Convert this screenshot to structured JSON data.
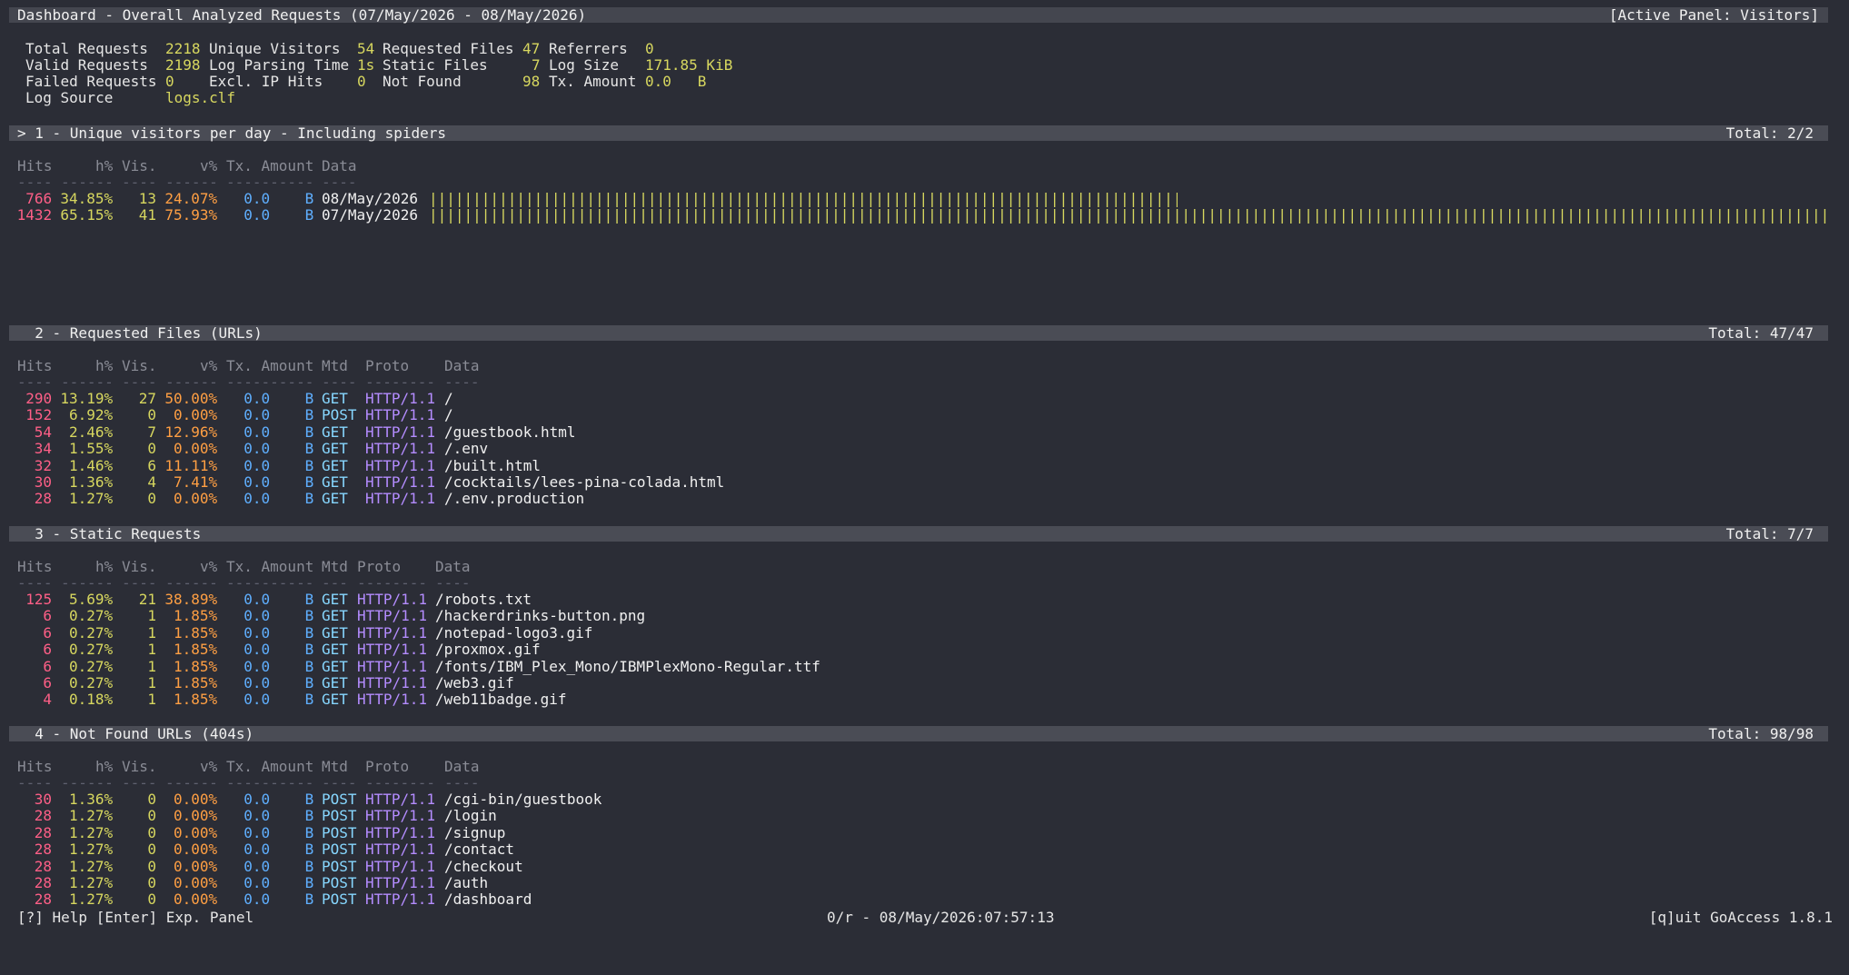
{
  "header": {
    "title": "Dashboard - Overall Analyzed Requests (07/May/2026 - 08/May/2026)",
    "active_panel": "[Active Panel: Visitors]"
  },
  "overview": {
    "total_requests_label": "Total Requests",
    "total_requests": "2218",
    "unique_visitors_label": "Unique Visitors",
    "unique_visitors": "54",
    "requested_files_label": "Requested Files",
    "requested_files": "47",
    "referrers_label": "Referrers",
    "referrers": "0",
    "valid_requests_label": "Valid Requests",
    "valid_requests": "2198",
    "log_parsing_time_label": "Log Parsing Time",
    "log_parsing_time": "1s",
    "static_files_label": "Static Files",
    "static_files": "7",
    "log_size_label": "Log Size",
    "log_size": "171.85 KiB",
    "failed_requests_label": "Failed Requests",
    "failed_requests": "0",
    "excl_ip_hits_label": "Excl. IP Hits",
    "excl_ip_hits": "0",
    "not_found_label": "Not Found",
    "not_found": "98",
    "tx_amount_label": "Tx. Amount",
    "tx_amount": "0.0   B",
    "log_source_label": "Log Source",
    "log_source": "logs.clf"
  },
  "panel1": {
    "title": "> 1 - Unique visitors per day - Including spiders",
    "total": "Total: 2/2",
    "headers": {
      "hits": "Hits",
      "hpct": "h%",
      "vis": "Vis.",
      "vpct": "v%",
      "tx": "Tx. Amount",
      "data": "Data"
    },
    "dashes": {
      "hits": "----",
      "hpct": "------",
      "vis": "----",
      "vpct": "------",
      "tx": "----------",
      "data": "----"
    },
    "rows": [
      {
        "hits": "766",
        "hpct": "34.85%",
        "vis": "13",
        "vpct": "24.07%",
        "tx": "0.0    B",
        "data": "08/May/2026",
        "bar_fraction": 0.535
      },
      {
        "hits": "1432",
        "hpct": "65.15%",
        "vis": "41",
        "vpct": "75.93%",
        "tx": "0.0    B",
        "data": "07/May/2026",
        "bar_fraction": 1.0
      }
    ]
  },
  "panel2": {
    "title": "  2 - Requested Files (URLs)",
    "total": "Total: 47/47",
    "headers": {
      "hits": "Hits",
      "hpct": "h%",
      "vis": "Vis.",
      "vpct": "v%",
      "tx": "Tx. Amount",
      "mtd": "Mtd",
      "proto": "Proto",
      "data": "Data"
    },
    "dashes": {
      "hits": "----",
      "hpct": "------",
      "vis": "----",
      "vpct": "------",
      "tx": "----------",
      "mtd": "----",
      "proto": "--------",
      "data": "----"
    },
    "rows": [
      {
        "hits": "290",
        "hpct": "13.19%",
        "vis": "27",
        "vpct": "50.00%",
        "tx": "0.0    B",
        "mtd": "GET",
        "proto": "HTTP/1.1",
        "data": "/"
      },
      {
        "hits": "152",
        "hpct": "6.92%",
        "vis": "0",
        "vpct": "0.00%",
        "tx": "0.0    B",
        "mtd": "POST",
        "proto": "HTTP/1.1",
        "data": "/"
      },
      {
        "hits": "54",
        "hpct": "2.46%",
        "vis": "7",
        "vpct": "12.96%",
        "tx": "0.0    B",
        "mtd": "GET",
        "proto": "HTTP/1.1",
        "data": "/guestbook.html"
      },
      {
        "hits": "34",
        "hpct": "1.55%",
        "vis": "0",
        "vpct": "0.00%",
        "tx": "0.0    B",
        "mtd": "GET",
        "proto": "HTTP/1.1",
        "data": "/.env"
      },
      {
        "hits": "32",
        "hpct": "1.46%",
        "vis": "6",
        "vpct": "11.11%",
        "tx": "0.0    B",
        "mtd": "GET",
        "proto": "HTTP/1.1",
        "data": "/built.html"
      },
      {
        "hits": "30",
        "hpct": "1.36%",
        "vis": "4",
        "vpct": "7.41%",
        "tx": "0.0    B",
        "mtd": "GET",
        "proto": "HTTP/1.1",
        "data": "/cocktails/lees-pina-colada.html"
      },
      {
        "hits": "28",
        "hpct": "1.27%",
        "vis": "0",
        "vpct": "0.00%",
        "tx": "0.0    B",
        "mtd": "GET",
        "proto": "HTTP/1.1",
        "data": "/.env.production"
      }
    ]
  },
  "panel3": {
    "title": "  3 - Static Requests",
    "total": "Total: 7/7",
    "headers": {
      "hits": "Hits",
      "hpct": "h%",
      "vis": "Vis.",
      "vpct": "v%",
      "tx": "Tx. Amount",
      "mtd": "Mtd",
      "proto": "Proto",
      "data": "Data"
    },
    "dashes": {
      "hits": "----",
      "hpct": "------",
      "vis": "----",
      "vpct": "------",
      "tx": "----------",
      "mtd": "---",
      "proto": "--------",
      "data": "----"
    },
    "rows": [
      {
        "hits": "125",
        "hpct": "5.69%",
        "vis": "21",
        "vpct": "38.89%",
        "tx": "0.0    B",
        "mtd": "GET",
        "proto": "HTTP/1.1",
        "data": "/robots.txt"
      },
      {
        "hits": "6",
        "hpct": "0.27%",
        "vis": "1",
        "vpct": "1.85%",
        "tx": "0.0    B",
        "mtd": "GET",
        "proto": "HTTP/1.1",
        "data": "/hackerdrinks-button.png"
      },
      {
        "hits": "6",
        "hpct": "0.27%",
        "vis": "1",
        "vpct": "1.85%",
        "tx": "0.0    B",
        "mtd": "GET",
        "proto": "HTTP/1.1",
        "data": "/notepad-logo3.gif"
      },
      {
        "hits": "6",
        "hpct": "0.27%",
        "vis": "1",
        "vpct": "1.85%",
        "tx": "0.0    B",
        "mtd": "GET",
        "proto": "HTTP/1.1",
        "data": "/proxmox.gif"
      },
      {
        "hits": "6",
        "hpct": "0.27%",
        "vis": "1",
        "vpct": "1.85%",
        "tx": "0.0    B",
        "mtd": "GET",
        "proto": "HTTP/1.1",
        "data": "/fonts/IBM_Plex_Mono/IBMPlexMono-Regular.ttf"
      },
      {
        "hits": "6",
        "hpct": "0.27%",
        "vis": "1",
        "vpct": "1.85%",
        "tx": "0.0    B",
        "mtd": "GET",
        "proto": "HTTP/1.1",
        "data": "/web3.gif"
      },
      {
        "hits": "4",
        "hpct": "0.18%",
        "vis": "1",
        "vpct": "1.85%",
        "tx": "0.0    B",
        "mtd": "GET",
        "proto": "HTTP/1.1",
        "data": "/web11badge.gif"
      }
    ]
  },
  "panel4": {
    "title": "  4 - Not Found URLs (404s)",
    "total": "Total: 98/98",
    "headers": {
      "hits": "Hits",
      "hpct": "h%",
      "vis": "Vis.",
      "vpct": "v%",
      "tx": "Tx. Amount",
      "mtd": "Mtd",
      "proto": "Proto",
      "data": "Data"
    },
    "dashes": {
      "hits": "----",
      "hpct": "------",
      "vis": "----",
      "vpct": "------",
      "tx": "----------",
      "mtd": "----",
      "proto": "--------",
      "data": "----"
    },
    "rows": [
      {
        "hits": "30",
        "hpct": "1.36%",
        "vis": "0",
        "vpct": "0.00%",
        "tx": "0.0    B",
        "mtd": "POST",
        "proto": "HTTP/1.1",
        "data": "/cgi-bin/guestbook"
      },
      {
        "hits": "28",
        "hpct": "1.27%",
        "vis": "0",
        "vpct": "0.00%",
        "tx": "0.0    B",
        "mtd": "POST",
        "proto": "HTTP/1.1",
        "data": "/login"
      },
      {
        "hits": "28",
        "hpct": "1.27%",
        "vis": "0",
        "vpct": "0.00%",
        "tx": "0.0    B",
        "mtd": "POST",
        "proto": "HTTP/1.1",
        "data": "/signup"
      },
      {
        "hits": "28",
        "hpct": "1.27%",
        "vis": "0",
        "vpct": "0.00%",
        "tx": "0.0    B",
        "mtd": "POST",
        "proto": "HTTP/1.1",
        "data": "/contact"
      },
      {
        "hits": "28",
        "hpct": "1.27%",
        "vis": "0",
        "vpct": "0.00%",
        "tx": "0.0    B",
        "mtd": "POST",
        "proto": "HTTP/1.1",
        "data": "/checkout"
      },
      {
        "hits": "28",
        "hpct": "1.27%",
        "vis": "0",
        "vpct": "0.00%",
        "tx": "0.0    B",
        "mtd": "POST",
        "proto": "HTTP/1.1",
        "data": "/auth"
      },
      {
        "hits": "28",
        "hpct": "1.27%",
        "vis": "0",
        "vpct": "0.00%",
        "tx": "0.0    B",
        "mtd": "POST",
        "proto": "HTTP/1.1",
        "data": "/dashboard"
      }
    ]
  },
  "footer": {
    "help": "[?] Help [Enter] Exp. Panel",
    "status": "0/r - 08/May/2026:07:57:13",
    "version": "[q]uit GoAccess 1.8.1"
  }
}
